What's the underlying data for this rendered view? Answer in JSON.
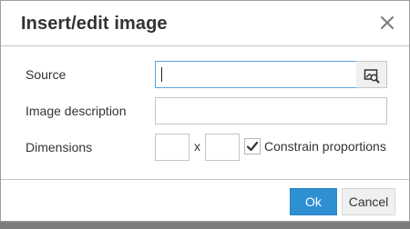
{
  "dialog": {
    "title": "Insert/edit image",
    "close_icon": "close-icon"
  },
  "form": {
    "source_label": "Source",
    "source_value": "",
    "browse_icon": "browse-image-icon",
    "description_label": "Image description",
    "description_value": "",
    "dimensions_label": "Dimensions",
    "width_value": "",
    "height_value": "",
    "dimension_separator": "x",
    "constrain_label": "Constrain proportions",
    "constrain_checked": true
  },
  "footer": {
    "ok_label": "Ok",
    "cancel_label": "Cancel"
  },
  "colors": {
    "primary_button": "#2f8fd3",
    "focus_border": "#59a5e5",
    "overlay": "#7d7d7d"
  }
}
